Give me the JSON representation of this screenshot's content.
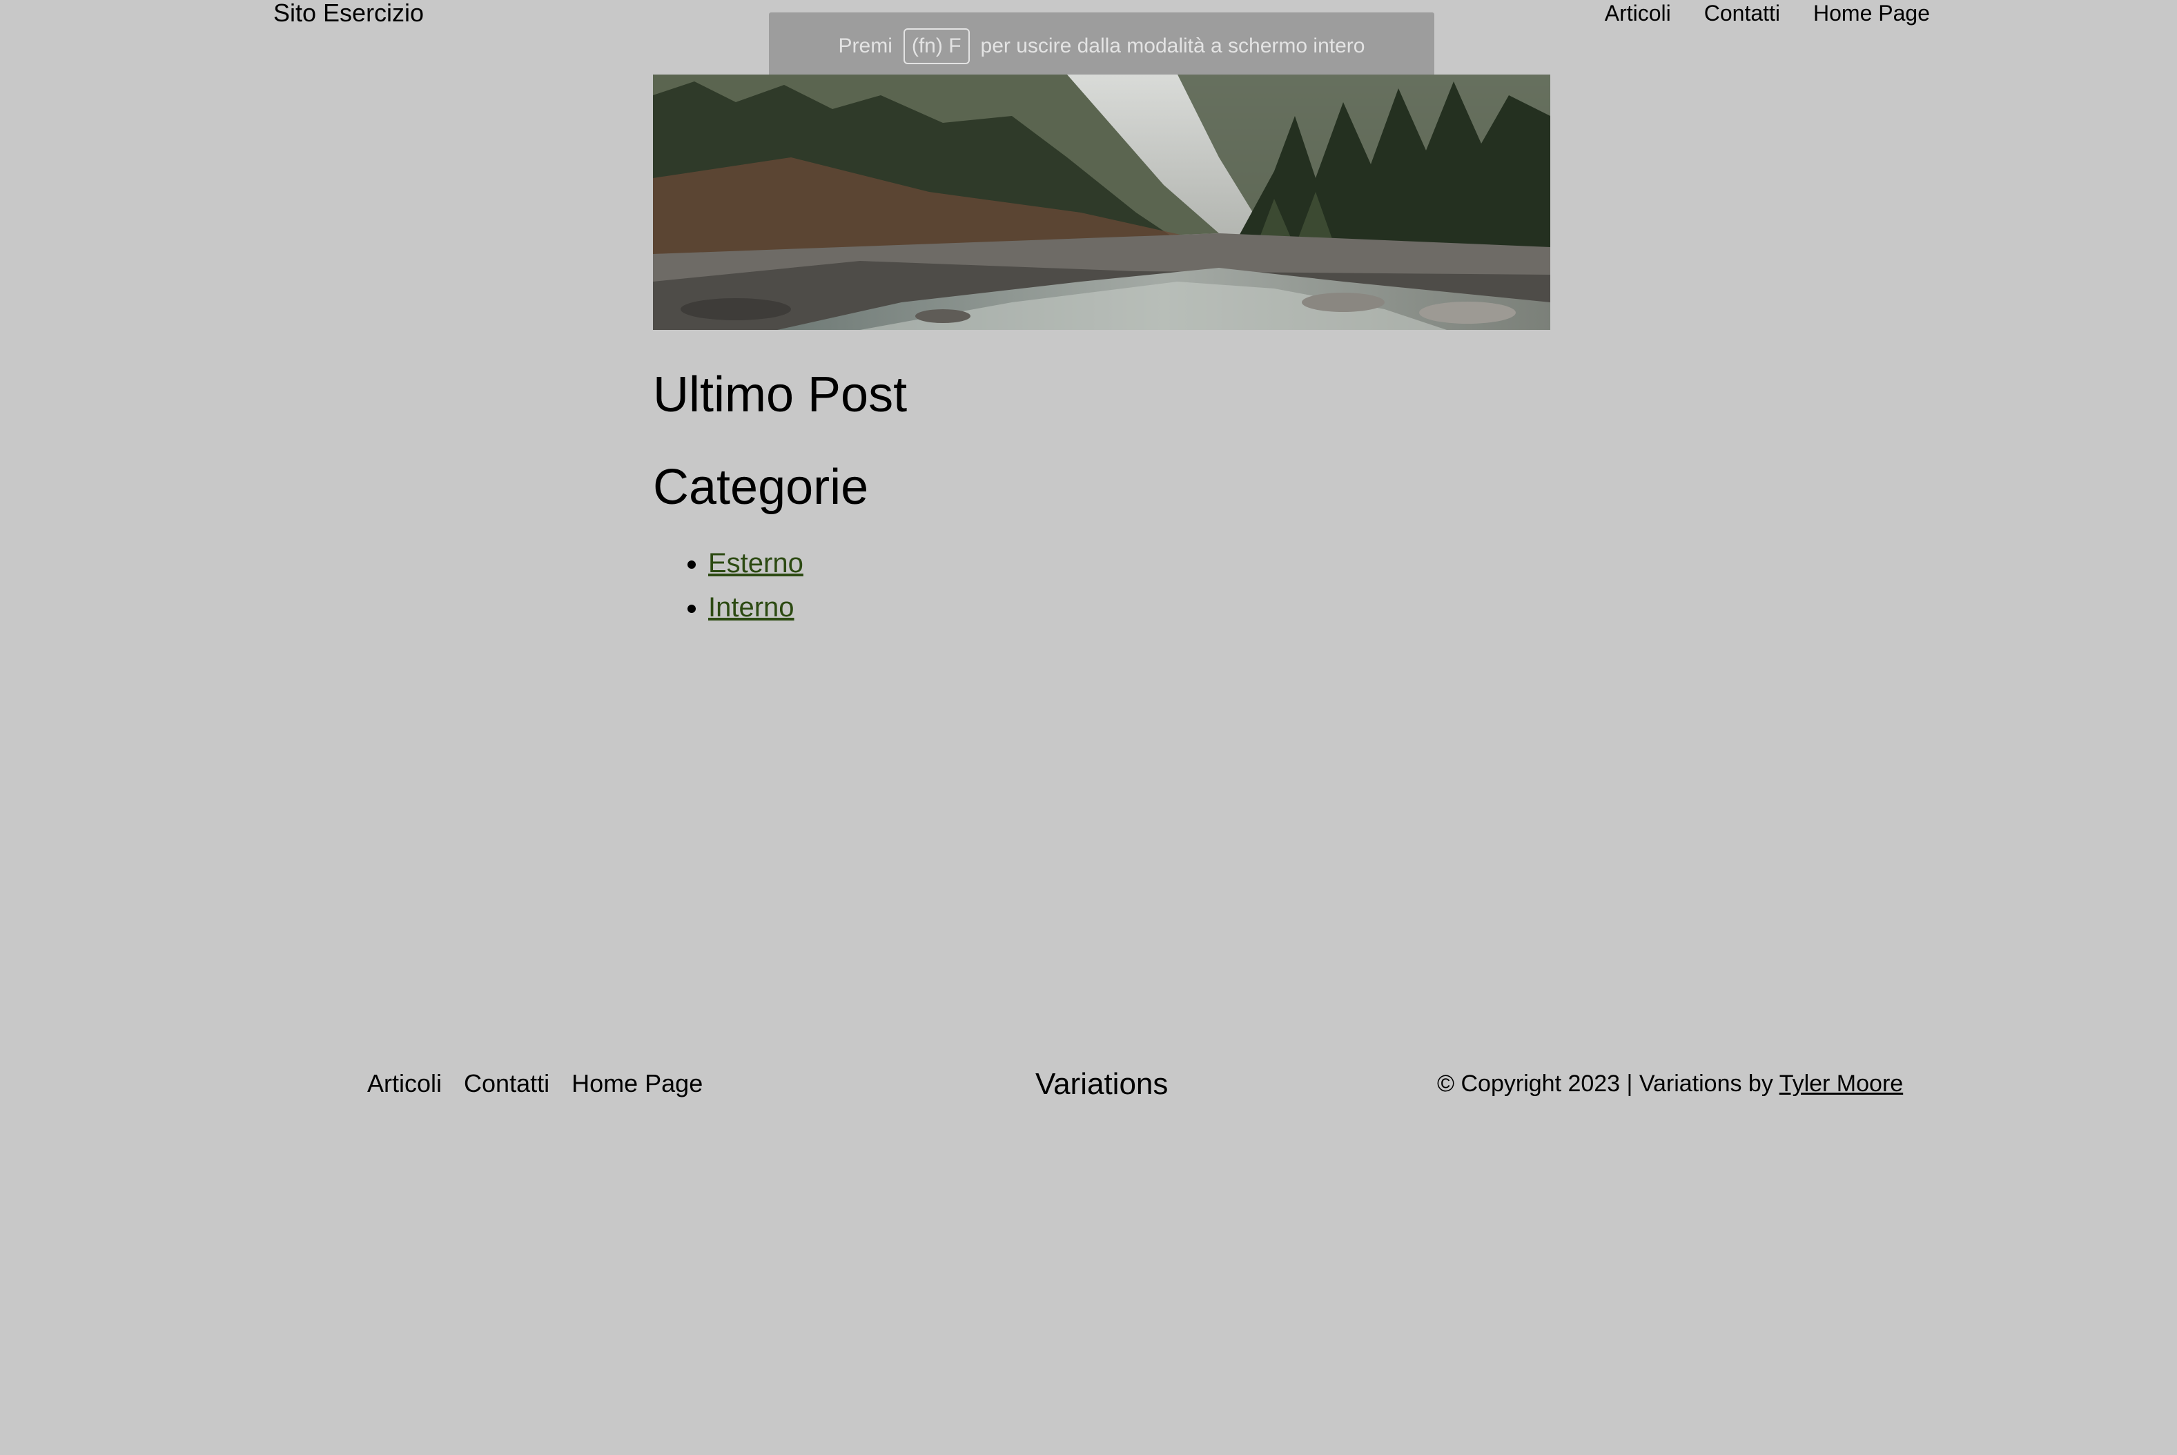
{
  "header": {
    "site_title": "Sito Esercizio",
    "nav": [
      "Articoli",
      "Contatti",
      "Home Page"
    ]
  },
  "fullscreen_banner": {
    "prefix": "Premi",
    "key": "(fn) F",
    "suffix": "per uscire dalla modalità a schermo intero"
  },
  "hero_image": {
    "alt": "river-forest-landscape",
    "colors": [
      "#6f7461",
      "#2f3a29",
      "#a7a39a",
      "#e1e3e6"
    ]
  },
  "main": {
    "heading_latest": "Ultimo Post",
    "heading_categories": "Categorie",
    "categories": [
      "Esterno",
      "Interno"
    ]
  },
  "footer": {
    "nav": [
      "Articoli",
      "Contatti",
      "Home Page"
    ],
    "brand": "Variations",
    "copyright_prefix": "© Copyright 2023 | Variations by ",
    "author": "Tyler Moore"
  },
  "colors": {
    "background": "#c8c8c8",
    "link_accent": "#2c4a12",
    "banner": "#9d9d9d"
  }
}
